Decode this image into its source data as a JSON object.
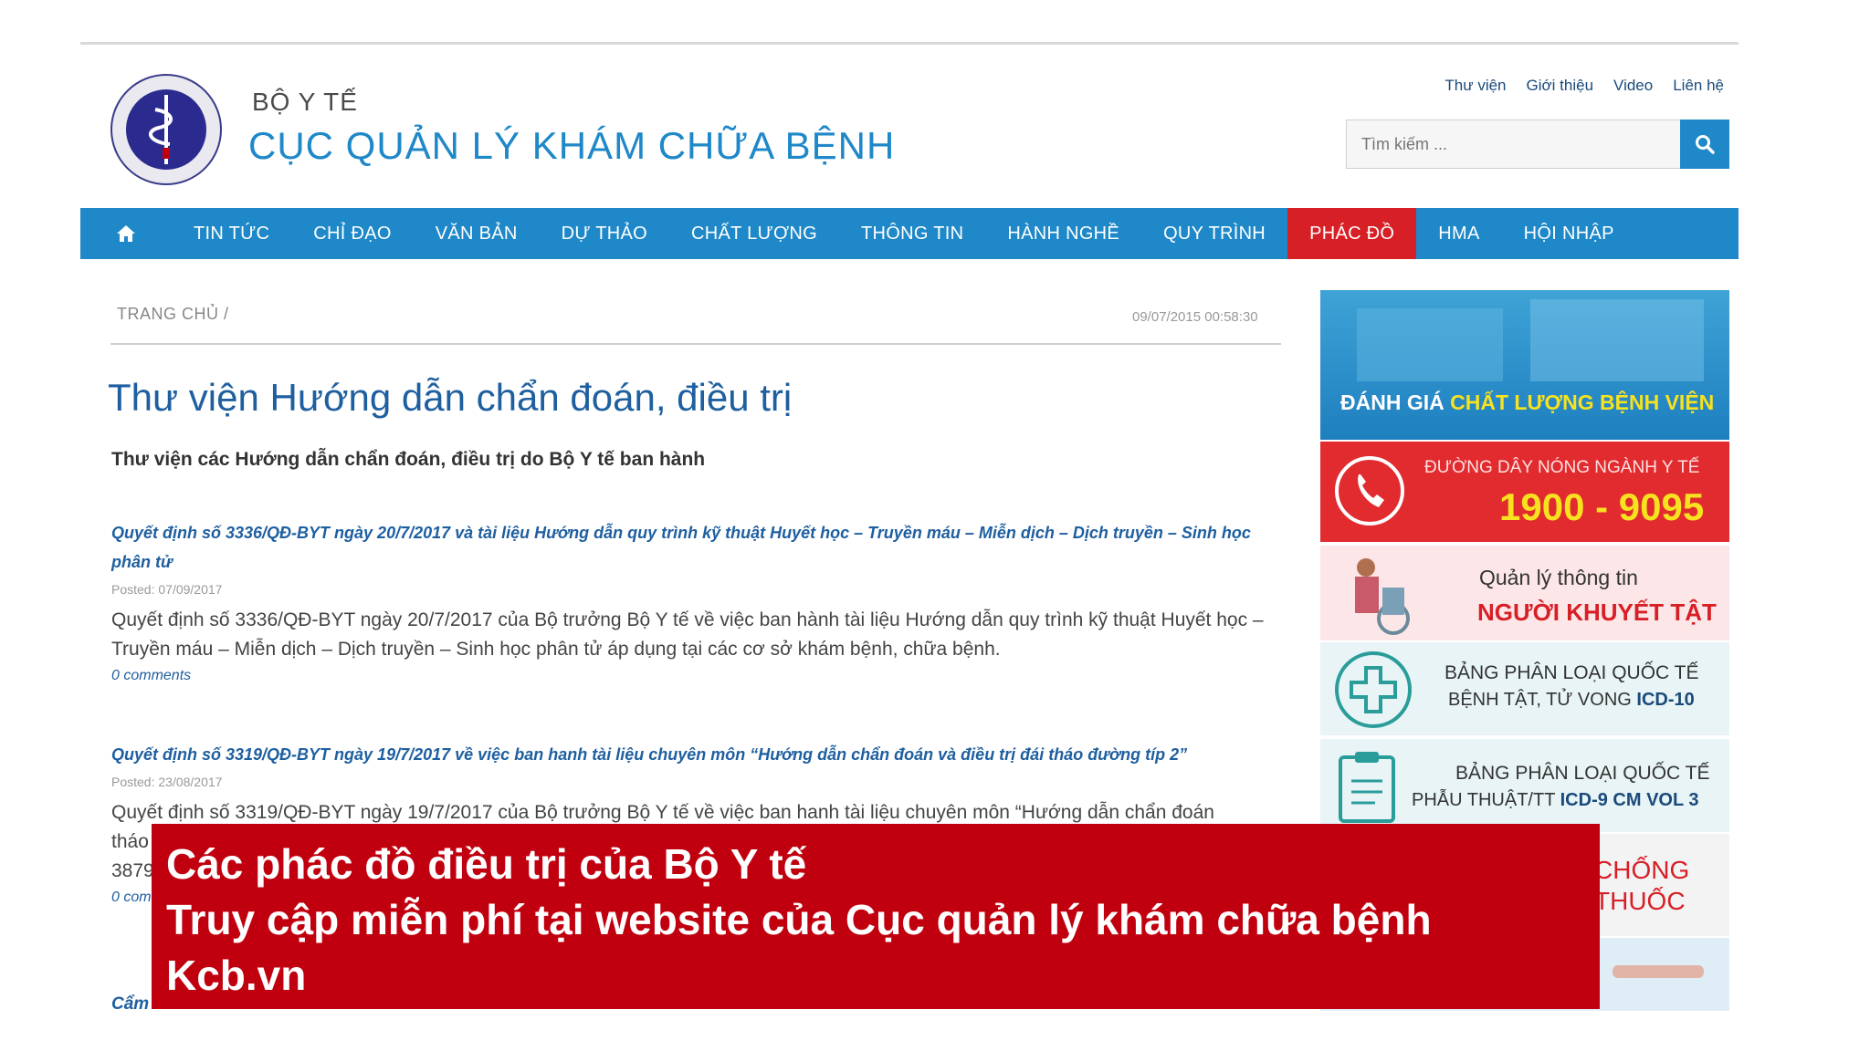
{
  "header": {
    "org_small": "BỘ Y TẾ",
    "org_big": "CỤC QUẢN LÝ KHÁM CHỮA BỆNH",
    "top_links": [
      "Thư viện",
      "Giới thiệu",
      "Video",
      "Liên hệ"
    ],
    "search_placeholder": "Tìm kiếm ..."
  },
  "nav": {
    "items": [
      "TIN TỨC",
      "CHỈ ĐẠO",
      "VĂN BẢN",
      "DỰ THẢO",
      "CHẤT LƯỢNG",
      "THÔNG TIN",
      "HÀNH NGHỀ",
      "QUY TRÌNH",
      "PHÁC ĐỒ",
      "HMA",
      "HỘI NHẬP"
    ],
    "active_index": 8
  },
  "breadcrumb": {
    "path": "TRANG CHỦ /",
    "timestamp": "09/07/2015 00:58:30"
  },
  "main": {
    "title": "Thư viện Hướng dẫn chẩn đoán, điều trị",
    "subtitle": "Thư viện các Hướng dẫn chẩn đoán, điều trị do Bộ Y tế ban hành",
    "posts": [
      {
        "title": "Quyết định số 3336/QĐ-BYT ngày 20/7/2017 và tài liệu Hướng dẫn quy trình kỹ thuật Huyết học – Truyền máu – Miễn dịch – Dịch truyền – Sinh học phân tử",
        "posted": "Posted: 07/09/2017",
        "excerpt": "Quyết định số 3336/QĐ-BYT ngày 20/7/2017 của Bộ trưởng Bộ Y tế về việc ban hành tài liệu Hướng dẫn quy trình kỹ thuật Huyết học – Truyền máu – Miễn dịch – Dịch truyền – Sinh học phân tử áp dụng tại các cơ sở khám bệnh, chữa bệnh.",
        "comments": "0 comments"
      },
      {
        "title": "Quyết định số 3319/QĐ-BYT ngày 19/7/2017 về việc ban hanh tài liệu chuyên môn “Hướng dẫn chẩn đoán và điều trị đái tháo đường típ 2”",
        "posted": "Posted: 23/08/2017",
        "excerpt": "Quyết định số 3319/QĐ-BYT ngày 19/7/2017 của Bộ trưởng Bộ Y tế về việc ban hanh tài liệu chuyên môn “Hướng dẫn chẩn đoán",
        "excerpt_hidden": [
          "tháo",
          "3879"
        ],
        "comments": "0 com"
      }
    ],
    "partial_next": "Cẩm"
  },
  "sidebar": {
    "quality": {
      "white": "ĐÁNH GIÁ",
      "yellow": "CHẤT LƯỢNG BỆNH VIỆN"
    },
    "hotline": {
      "label": "ĐƯỜNG DÂY NÓNG NGÀNH Y TẾ",
      "number": "1900 - 9095"
    },
    "disability": {
      "line1": "Quản lý thông tin",
      "line2": "NGƯỜI KHUYẾT TẬT"
    },
    "icd10": {
      "line1": "BẢNG PHÂN LOẠI QUỐC TẾ",
      "line2": "BỆNH TẬT, TỬ VONG",
      "code": "ICD-10"
    },
    "icd9": {
      "line1": "BẢNG PHÂN LOẠI QUỐC TẾ",
      "line2": "PHẪU THUẬT/TT",
      "code": "ICD-9 CM VOL 3"
    },
    "drug": {
      "line1": "CHỐNG",
      "line2": "THUỐC"
    }
  },
  "caption": {
    "line1": "Các phác đồ điều trị của Bộ Y tế",
    "line2": "Truy cập miễn phí tại website của Cục quản lý khám chữa bệnh",
    "line3": "Kcb.vn"
  },
  "colors": {
    "brand_blue": "#1e88c8",
    "active_red": "#d71f26",
    "caption_red": "#c0000f",
    "link_blue": "#1e5fa0"
  }
}
